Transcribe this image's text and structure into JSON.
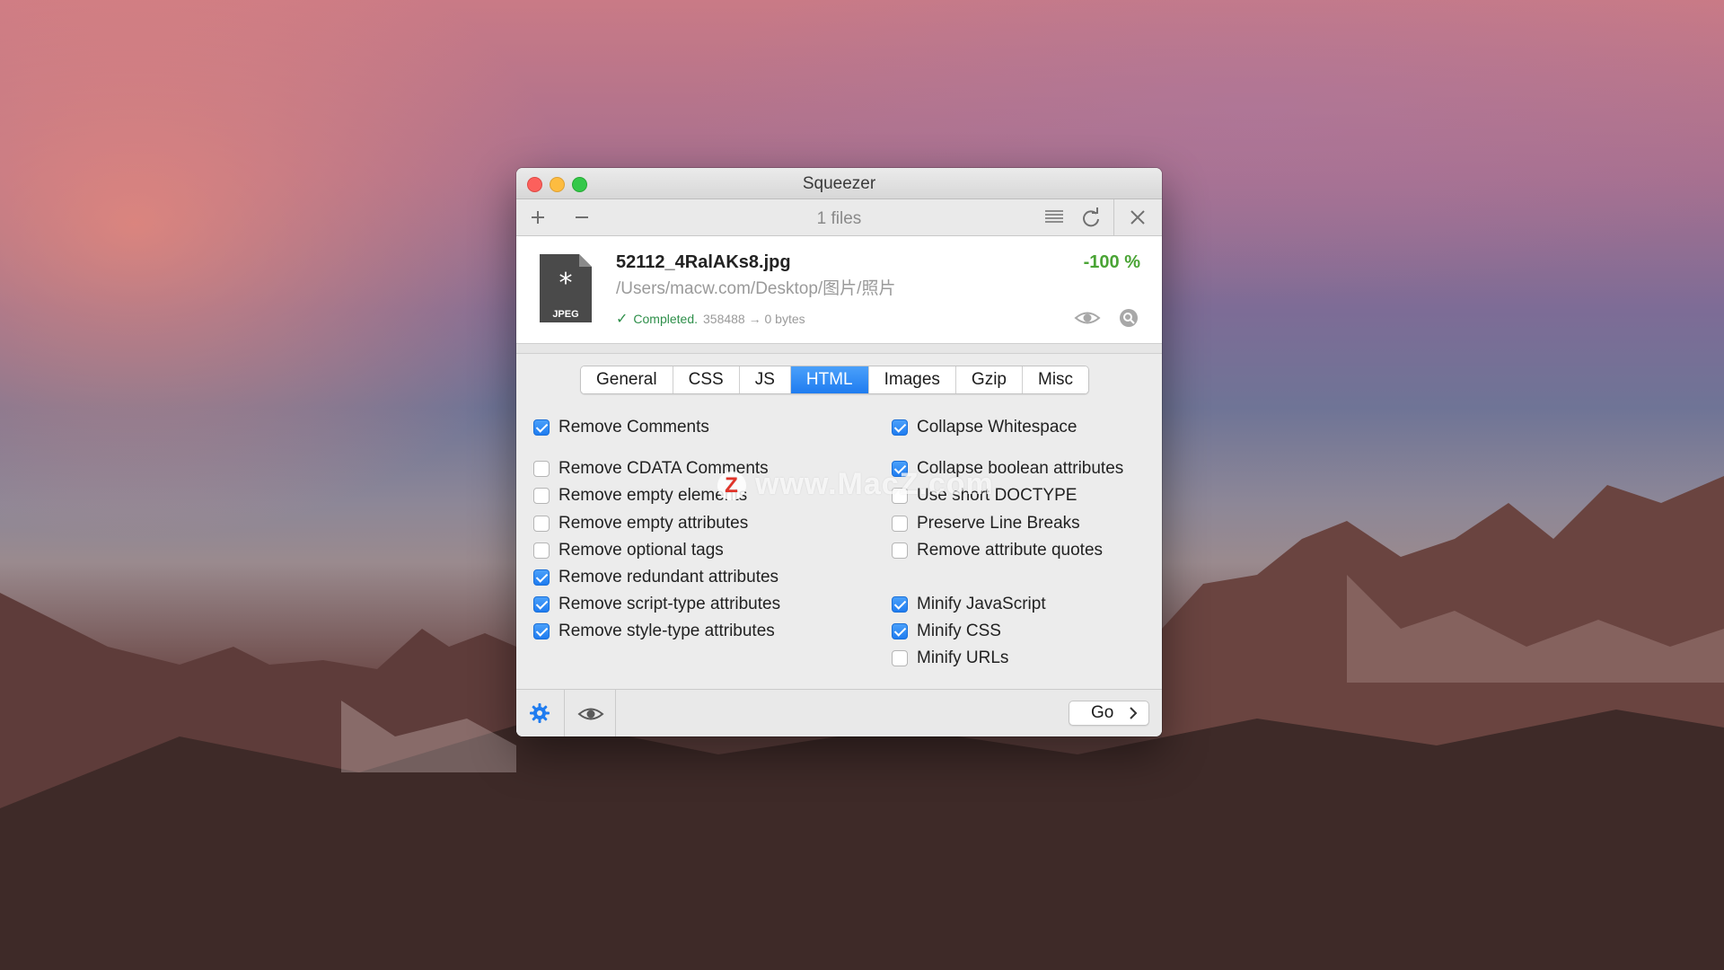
{
  "window": {
    "title": "Squeezer"
  },
  "toolbar": {
    "add_icon": "plus-icon",
    "remove_icon": "minus-icon",
    "files_count": "1 files",
    "list_icon": "list-icon",
    "refresh_icon": "refresh-icon",
    "close_icon": "close-icon"
  },
  "file": {
    "icon_label": "JPEG",
    "name": "52112_4RalAKs8.jpg",
    "path": "/Users/macw.com/Desktop/图片/照片",
    "percent": "-100 %",
    "status": "Completed.",
    "size": "358488 → 0 bytes",
    "status_color": "#2e8f4a",
    "percent_color": "#4aa435"
  },
  "tabs": [
    {
      "label": "General",
      "active": false
    },
    {
      "label": "CSS",
      "active": false
    },
    {
      "label": "JS",
      "active": false
    },
    {
      "label": "HTML",
      "active": true
    },
    {
      "label": "Images",
      "active": false
    },
    {
      "label": "Gzip",
      "active": false
    },
    {
      "label": "Misc",
      "active": false
    }
  ],
  "options": {
    "left": [
      {
        "label": "Remove Comments",
        "checked": true
      },
      {
        "label": "Remove CDATA Comments",
        "checked": false
      },
      {
        "label": "Remove empty elements",
        "checked": false
      },
      {
        "label": "Remove empty attributes",
        "checked": false
      },
      {
        "label": "Remove optional tags",
        "checked": false
      },
      {
        "label": "Remove redundant attributes",
        "checked": true
      },
      {
        "label": "Remove script-type attributes",
        "checked": true
      },
      {
        "label": "Remove style-type attributes",
        "checked": true
      }
    ],
    "right": [
      {
        "label": "Collapse Whitespace",
        "checked": true
      },
      {
        "label": "Collapse boolean attributes",
        "checked": true
      },
      {
        "label": "Use short DOCTYPE",
        "checked": false
      },
      {
        "label": "Preserve Line Breaks",
        "checked": false
      },
      {
        "label": "Remove attribute quotes",
        "checked": false
      },
      {
        "label": "Minify JavaScript",
        "checked": true
      },
      {
        "label": "Minify CSS",
        "checked": true
      },
      {
        "label": "Minify URLs",
        "checked": false
      }
    ]
  },
  "watermark": {
    "logo": "Z",
    "text": "www.MacZ.com"
  },
  "bottom": {
    "settings_icon": "gear-icon",
    "preview_icon": "eye-icon",
    "go_label": "Go"
  },
  "colors": {
    "accent": "#1f7cf0"
  }
}
